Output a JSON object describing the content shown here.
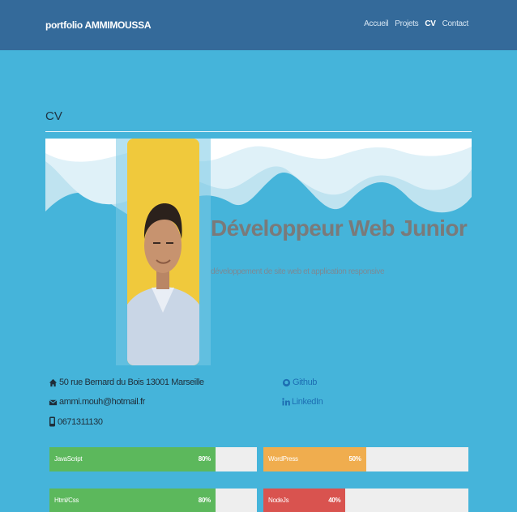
{
  "navbar": {
    "brand": "portfolio AMMIMOUSSA",
    "links": [
      {
        "label": "Accueil",
        "active": false
      },
      {
        "label": "Projets",
        "active": false
      },
      {
        "label": "CV",
        "active": true
      },
      {
        "label": "Contact",
        "active": false
      }
    ]
  },
  "section": {
    "title": "CV"
  },
  "hero": {
    "title": "Développeur Web Junior",
    "subtitle": "développement de site web et application responsive"
  },
  "contact": {
    "address": "50 rue Bernard du Bois 13001 Marseille",
    "email": "ammi.mouh@hotmail.fr",
    "phone": "0671311130",
    "github": "Github",
    "linkedin": "LinkedIn"
  },
  "skills": [
    {
      "name": "JavaScript",
      "percent": 80,
      "label": "80%",
      "color": "#5cb85c"
    },
    {
      "name": "WordPress",
      "percent": 50,
      "label": "50%",
      "color": "#f0ad4e"
    },
    {
      "name": "Html/Css",
      "percent": 80,
      "label": "80%",
      "color": "#5cb85c"
    },
    {
      "name": "NodeJs",
      "percent": 40,
      "label": "40%",
      "color": "#d9534f"
    }
  ],
  "colors": {
    "navbar": "#346a9a",
    "page": "#45b4da",
    "success": "#5cb85c",
    "warning": "#f0ad4e",
    "danger": "#d9534f"
  }
}
